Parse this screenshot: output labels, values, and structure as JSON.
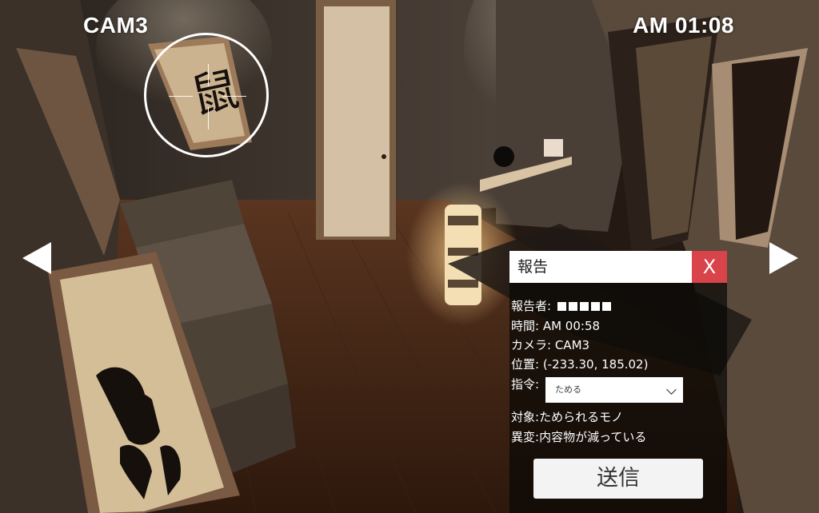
{
  "hud": {
    "camera_label": "CAM3",
    "clock": "AM 01:08"
  },
  "scene": {
    "scroll_upper_kanji": "鼠",
    "description_icons": [
      "arrow-left-icon",
      "arrow-right-icon",
      "focus-reticle-icon"
    ]
  },
  "report": {
    "title": "報告",
    "close_label": "X",
    "reporter_label": "報告者: ",
    "reporter_redacted_count": 5,
    "time_label": "時間: ",
    "time_value": "AM 00:58",
    "camera_label": "カメラ: ",
    "camera_value": "CAM3",
    "position_label": "位置: ",
    "position_value": "(-233.30, 185.02)",
    "order_label": "指令:",
    "order_selected": "ためる",
    "target_label": "対象:",
    "target_value": "ためられるモノ",
    "anomaly_label": "異変:",
    "anomaly_value": "内容物が減っている",
    "submit_label": "送信"
  },
  "colors": {
    "close_button": "#d9434a",
    "panel_background": "rgba(10,8,6,0.72)",
    "hud_text": "#ffffff"
  }
}
